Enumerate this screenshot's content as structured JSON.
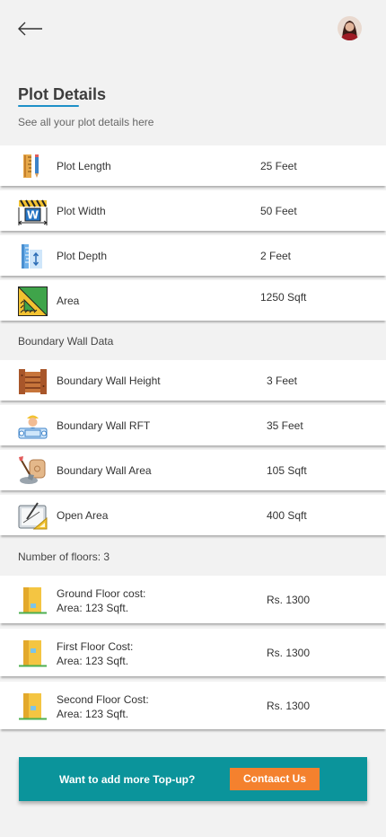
{
  "header": {
    "back_icon": "arrow-left-icon",
    "avatar_icon": "user-avatar"
  },
  "page": {
    "title": "Plot Details",
    "subtitle": "See all your plot details here"
  },
  "plot_rows": [
    {
      "label": "Plot Length",
      "value": "25 Feet",
      "icon": "ruler-icon"
    },
    {
      "label": "Plot Width",
      "value": "50 Feet",
      "icon": "width-measure-icon"
    },
    {
      "label": "Plot Depth",
      "value": "2 Feet",
      "icon": "depth-gauge-icon"
    },
    {
      "label": "Area",
      "value": "1250 Sqft",
      "icon": "set-square-icon"
    }
  ],
  "boundary": {
    "heading": "Boundary Wall Data",
    "rows": [
      {
        "label": "Boundary Wall Height",
        "value": "3 Feet",
        "icon": "wooden-fence-icon"
      },
      {
        "label": "Boundary Wall RFT",
        "value": "35 Feet",
        "icon": "engineer-blueprint-icon"
      },
      {
        "label": "Boundary Wall Area",
        "value": "105 Sqft",
        "icon": "cement-shovel-icon"
      },
      {
        "label": "Open Area",
        "value": "400 Sqft",
        "icon": "drafting-board-icon"
      }
    ]
  },
  "floors": {
    "heading": "Number of floors: 3",
    "rows": [
      {
        "label": "Ground Floor cost:\nArea: 123 Sqft.",
        "value": "Rs. 1300",
        "icon": "building-floor-icon"
      },
      {
        "label": "First Floor Cost:\nArea: 123 Sqft.",
        "value": "Rs. 1300",
        "icon": "building-floor-icon"
      },
      {
        "label": "Second Floor Cost:\nArea: 123 Sqft.",
        "value": "Rs. 1300",
        "icon": "building-floor-icon"
      }
    ]
  },
  "cta": {
    "text": "Want to add more Top-up?",
    "button_label": "Contaact Us"
  },
  "colors": {
    "accent": "#0b949b",
    "button": "#f4812e",
    "underline": "#1e90c8"
  }
}
